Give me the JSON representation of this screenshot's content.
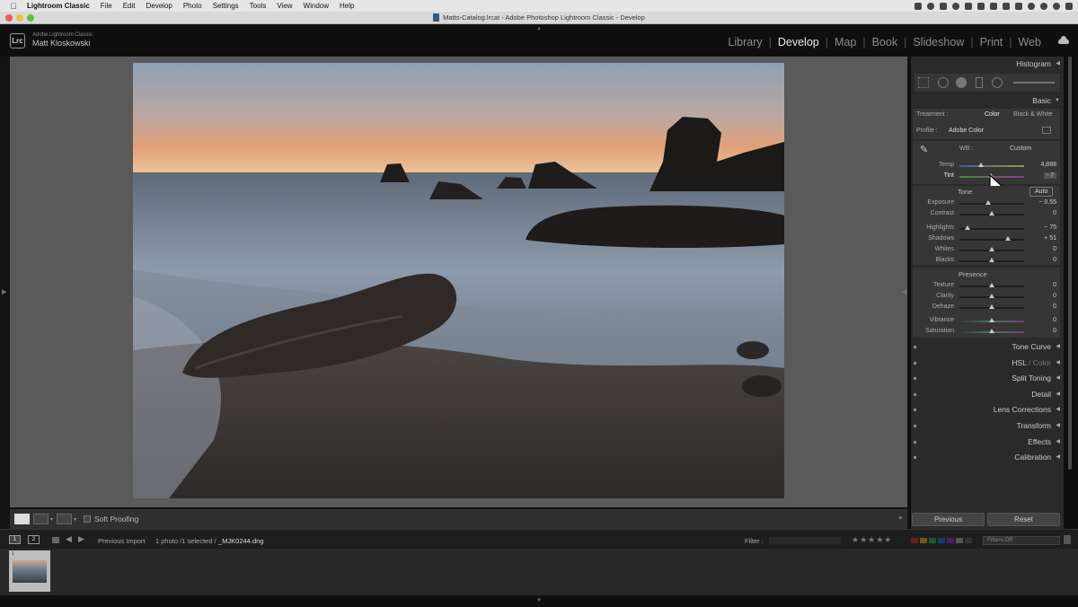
{
  "menubar": {
    "app_name": "Lightroom Classic",
    "items": [
      "File",
      "Edit",
      "Develop",
      "Photo",
      "Settings",
      "Tools",
      "View",
      "Window",
      "Help"
    ]
  },
  "window": {
    "title": "Matts-Catalog.lrcat - Adobe Photoshop Lightroom Classic - Develop"
  },
  "identity": {
    "badge": "Lrc",
    "app_name": "Adobe Lightroom Classic",
    "user_name": "Matt Kloskowski"
  },
  "modules": [
    "Library",
    "Develop",
    "Map",
    "Book",
    "Slideshow",
    "Print",
    "Web"
  ],
  "active_module": "Develop",
  "toolbar": {
    "soft_proofing_label": "Soft Proofing"
  },
  "right_panel": {
    "histogram_title": "Histogram",
    "basic_title": "Basic",
    "treatment_label": "Treatment :",
    "treatment_options": [
      "Color",
      "Black & White"
    ],
    "treatment_selected": "Color",
    "profile_label": "Profile :",
    "profile_value": "Adobe Color",
    "wb_label": "WB :",
    "wb_value": "Custom",
    "temp": {
      "label": "Temp",
      "value": "4,888",
      "position": 0.32
    },
    "tint": {
      "label": "Tint",
      "value": "- 7",
      "position": 0.48
    },
    "tone_label": "Tone",
    "auto_label": "Auto",
    "tone_sliders": [
      {
        "label": "Exposure",
        "value": "− 0.55",
        "position": 0.45
      },
      {
        "label": "Contrast",
        "value": "0",
        "position": 0.5
      },
      {
        "label": "Highlights",
        "value": "− 75",
        "position": 0.13
      },
      {
        "label": "Shadows",
        "value": "+ 51",
        "position": 0.75
      },
      {
        "label": "Whites",
        "value": "0",
        "position": 0.5
      },
      {
        "label": "Blacks",
        "value": "0",
        "position": 0.5
      }
    ],
    "presence_label": "Presence",
    "presence_sliders": [
      {
        "label": "Texture",
        "value": "0",
        "position": 0.5
      },
      {
        "label": "Clarity",
        "value": "0",
        "position": 0.5
      },
      {
        "label": "Dehaze",
        "value": "0",
        "position": 0.5
      },
      {
        "label": "Vibrance",
        "value": "0",
        "position": 0.5
      },
      {
        "label": "Saturation",
        "value": "0",
        "position": 0.5
      }
    ],
    "panels": [
      "Tone Curve",
      "HSL",
      "Split Toning",
      "Detail",
      "Lens Corrections",
      "Transform",
      "Effects",
      "Calibration"
    ],
    "hsl_suffix": "/ Color",
    "previous_label": "Previous",
    "reset_label": "Reset"
  },
  "filmstrip_bar": {
    "monitor1": "1",
    "monitor2": "2",
    "source": "Previous Import",
    "count": "1 photo /1 selected /",
    "filename": "_MJK0244.dng",
    "filter_label": "Filter :",
    "filters_off": "Filters Off",
    "swatch_colors": [
      "#6a1e1e",
      "#6a5a1e",
      "#1e5a2a",
      "#1e3a6a",
      "#4a1e6a",
      "#555555",
      "#333333"
    ]
  },
  "thumbnail": {
    "index": "1"
  },
  "colors": {
    "panel_bg": "#2a2a2a",
    "accent_text": "#eaeaea"
  }
}
